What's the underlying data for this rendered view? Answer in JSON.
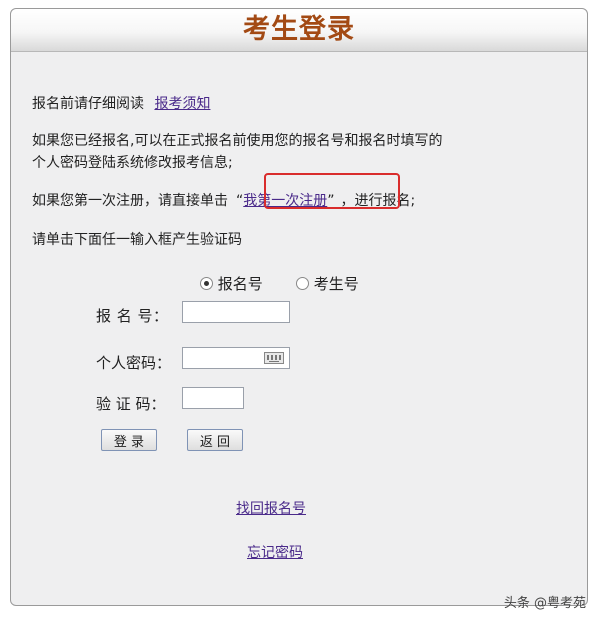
{
  "header": {
    "title": "考生登录"
  },
  "notice": {
    "prefix": "报名前请仔细阅读",
    "link": "报考须知"
  },
  "info": {
    "line1": "如果您已经报名,可以在正式报名前使用您的报名号和报名时填写的",
    "line2": "个人密码登陆系统修改报考信息;"
  },
  "register": {
    "prefix": "如果您第一次注册，请直接单击",
    "quote_open": "“",
    "link": "我第一次注册",
    "quote_close": "”",
    "suffix": "，进行报名;"
  },
  "instruction": "请单击下面任一输入框产生验证码",
  "radios": {
    "option1": "报名号",
    "option2": "考生号",
    "selected": "报名号"
  },
  "form": {
    "reg_no_label": "报  名  号：",
    "password_label": "个人密码：",
    "captcha_label": "验  证  码："
  },
  "buttons": {
    "login": "登 录",
    "back": "返 回"
  },
  "links": {
    "find_reg_no": "找回报名号",
    "forgot_password": "忘记密码"
  },
  "watermark": "头条 @粤考苑",
  "colors": {
    "title": "#a34a14",
    "highlight_border": "#d92c2c",
    "link": "#4a2a8a"
  }
}
